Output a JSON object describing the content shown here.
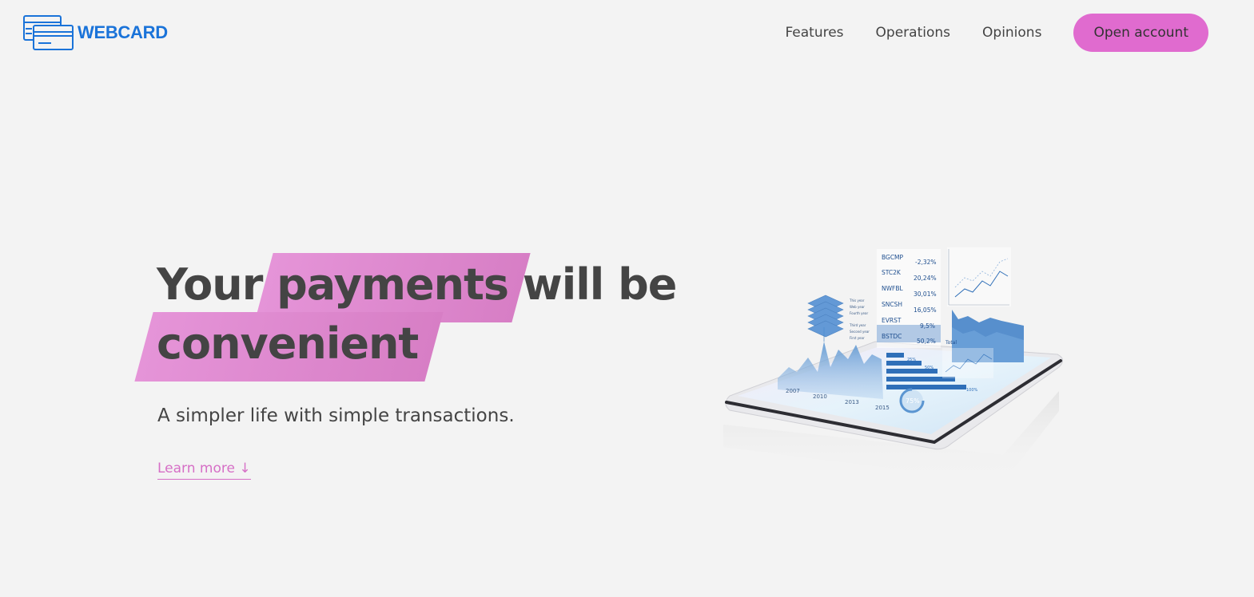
{
  "brand": {
    "name": "WEBCARD",
    "logo_icon": "cards-icon",
    "color": "#1a73d9"
  },
  "nav": {
    "links": [
      "Features",
      "Operations",
      "Opinions"
    ],
    "cta_label": "Open account",
    "cta_color": "#e06bcf"
  },
  "hero": {
    "title_prefix": "Your",
    "title_highlight_1": "payments",
    "title_suffix": "will be",
    "title_highlight_2": "convenient",
    "subtitle": "A simpler life with simple transactions.",
    "learn_more": "Learn more ↓",
    "accent": "#e06bcf"
  },
  "illustration": {
    "tickers": [
      {
        "symbol": "BGCMP",
        "value": "-2,32%"
      },
      {
        "symbol": "STC2K",
        "value": "20,24%"
      },
      {
        "symbol": "NWFBL",
        "value": "30,01%"
      },
      {
        "symbol": "SNCSH",
        "value": "16,05%"
      },
      {
        "symbol": "EVRST",
        "value": "9,5%"
      },
      {
        "symbol": "BSTDC",
        "value": "50,2%"
      }
    ],
    "years": [
      "2007",
      "2010",
      "2013",
      "2015"
    ],
    "gauge_label": "75%",
    "bar_labels": [
      "25%",
      "50%",
      "19%",
      "100%"
    ],
    "legend_items": [
      "This year",
      "Web year",
      "Fourth year",
      "Third year",
      "Second year",
      "First year"
    ],
    "panel_label": "Total"
  }
}
